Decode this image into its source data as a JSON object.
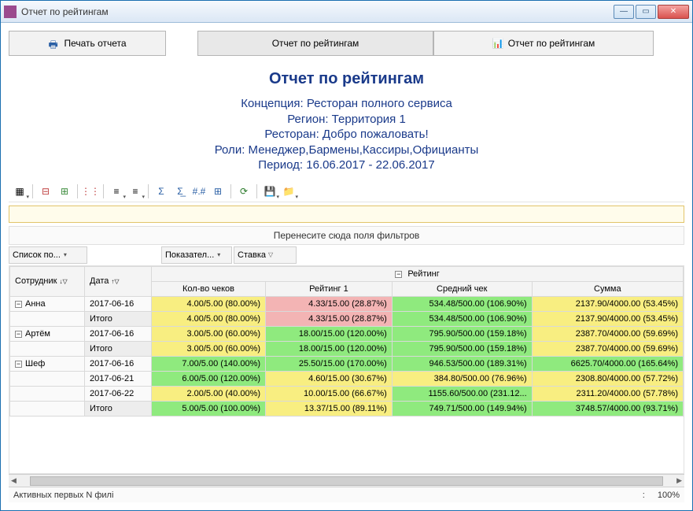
{
  "window": {
    "title": "Отчет по рейтингам"
  },
  "tabs": {
    "print": "Печать отчета",
    "report1": "Отчет по рейтингам",
    "report2": "Отчет по рейтингам"
  },
  "header": {
    "title": "Отчет по рейтингам",
    "concept": "Концепция: Ресторан полного сервиса",
    "region": "Регион: Территория 1",
    "restaurant": "Ресторан: Добро пожаловать!",
    "roles": "Роли: Менеджер,Бармены,Кассиры,Официанты",
    "period": "Период: 16.06.2017 - 22.06.2017"
  },
  "dropzone": "Перенесите сюда поля фильтров",
  "fields": {
    "list": "Список по...",
    "indicator": "Показател...",
    "rate": "Ставка",
    "employee": "Сотрудник",
    "date": "Дата"
  },
  "columns": {
    "group": "Рейтинг",
    "c1": "Кол-во чеков",
    "c2": "Рейтинг 1",
    "c3": "Средний чек",
    "c4": "Сумма"
  },
  "rows": [
    {
      "emp": "Анна",
      "date": "2017-06-16",
      "v": [
        "4.00/5.00 (80.00%)",
        "4.33/15.00 (28.87%)",
        "534.48/500.00 (106.90%)",
        "2137.90/4000.00 (53.45%)"
      ],
      "cls": [
        "yellow",
        "pink",
        "green",
        "yellow"
      ]
    },
    {
      "emp": "",
      "date": "Итого",
      "v": [
        "4.00/5.00 (80.00%)",
        "4.33/15.00 (28.87%)",
        "534.48/500.00 (106.90%)",
        "2137.90/4000.00 (53.45%)"
      ],
      "cls": [
        "yellow",
        "pink",
        "green",
        "yellow"
      ]
    },
    {
      "emp": "Артём",
      "date": "2017-06-16",
      "v": [
        "3.00/5.00 (60.00%)",
        "18.00/15.00 (120.00%)",
        "795.90/500.00 (159.18%)",
        "2387.70/4000.00 (59.69%)"
      ],
      "cls": [
        "yellow",
        "green",
        "green",
        "yellow"
      ]
    },
    {
      "emp": "",
      "date": "Итого",
      "v": [
        "3.00/5.00 (60.00%)",
        "18.00/15.00 (120.00%)",
        "795.90/500.00 (159.18%)",
        "2387.70/4000.00 (59.69%)"
      ],
      "cls": [
        "yellow",
        "green",
        "green",
        "yellow"
      ]
    },
    {
      "emp": "Шеф",
      "date": "2017-06-16",
      "v": [
        "7.00/5.00 (140.00%)",
        "25.50/15.00 (170.00%)",
        "946.53/500.00 (189.31%)",
        "6625.70/4000.00 (165.64%)"
      ],
      "cls": [
        "green",
        "green",
        "green",
        "green"
      ]
    },
    {
      "emp": "",
      "date": "2017-06-21",
      "v": [
        "6.00/5.00 (120.00%)",
        "4.60/15.00 (30.67%)",
        "384.80/500.00 (76.96%)",
        "2308.80/4000.00 (57.72%)"
      ],
      "cls": [
        "green",
        "yellow",
        "yellow",
        "yellow"
      ]
    },
    {
      "emp": "",
      "date": "2017-06-22",
      "v": [
        "2.00/5.00 (40.00%)",
        "10.00/15.00 (66.67%)",
        "1155.60/500.00 (231.12...",
        "2311.20/4000.00 (57.78%)"
      ],
      "cls": [
        "yellow",
        "yellow",
        "green",
        "yellow"
      ]
    },
    {
      "emp": "",
      "date": "Итого",
      "v": [
        "5.00/5.00 (100.00%)",
        "13.37/15.00 (89.11%)",
        "749.71/500.00 (149.94%)",
        "3748.57/4000.00 (93.71%)"
      ],
      "cls": [
        "green",
        "yellow",
        "green",
        "green"
      ]
    }
  ],
  "status": {
    "left": "Активных первых N филі",
    "zoom": "100%"
  }
}
